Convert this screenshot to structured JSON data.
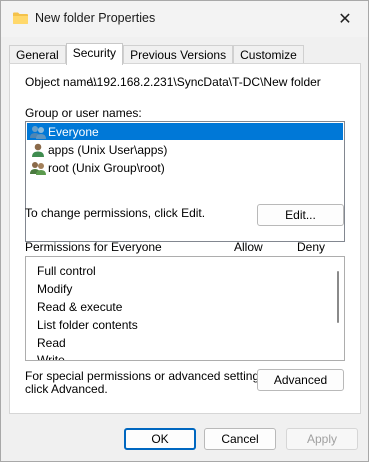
{
  "window": {
    "title": "New folder Properties",
    "close_symbol": "✕"
  },
  "tabs": [
    {
      "label": "General"
    },
    {
      "label": "Security",
      "active": true
    },
    {
      "label": "Previous Versions"
    },
    {
      "label": "Customize"
    }
  ],
  "security": {
    "object_name_label": "Object name:",
    "object_name_value": "\\\\192.168.2.231\\SyncData\\T-DC\\New folder",
    "group_label": "Group or user names:",
    "users": [
      {
        "name": "Everyone",
        "icon": "group-icon",
        "selected": true
      },
      {
        "name": "apps (Unix User\\apps)",
        "icon": "user-icon",
        "selected": false
      },
      {
        "name": "root (Unix Group\\root)",
        "icon": "group-icon",
        "selected": false
      }
    ],
    "change_text": "To change permissions, click Edit.",
    "edit_label": "Edit...",
    "permissions_label": "Permissions for Everyone",
    "allow_label": "Allow",
    "deny_label": "Deny",
    "permissions": [
      "Full control",
      "Modify",
      "Read & execute",
      "List folder contents",
      "Read",
      "Write"
    ],
    "advanced_text_line1": "For special permissions or advanced settings,",
    "advanced_text_line2": "click Advanced.",
    "advanced_label": "Advanced"
  },
  "footer": {
    "ok": "OK",
    "cancel": "Cancel",
    "apply": "Apply"
  },
  "colors": {
    "selection": "#0078d7",
    "default_button_border": "#0067c0"
  }
}
